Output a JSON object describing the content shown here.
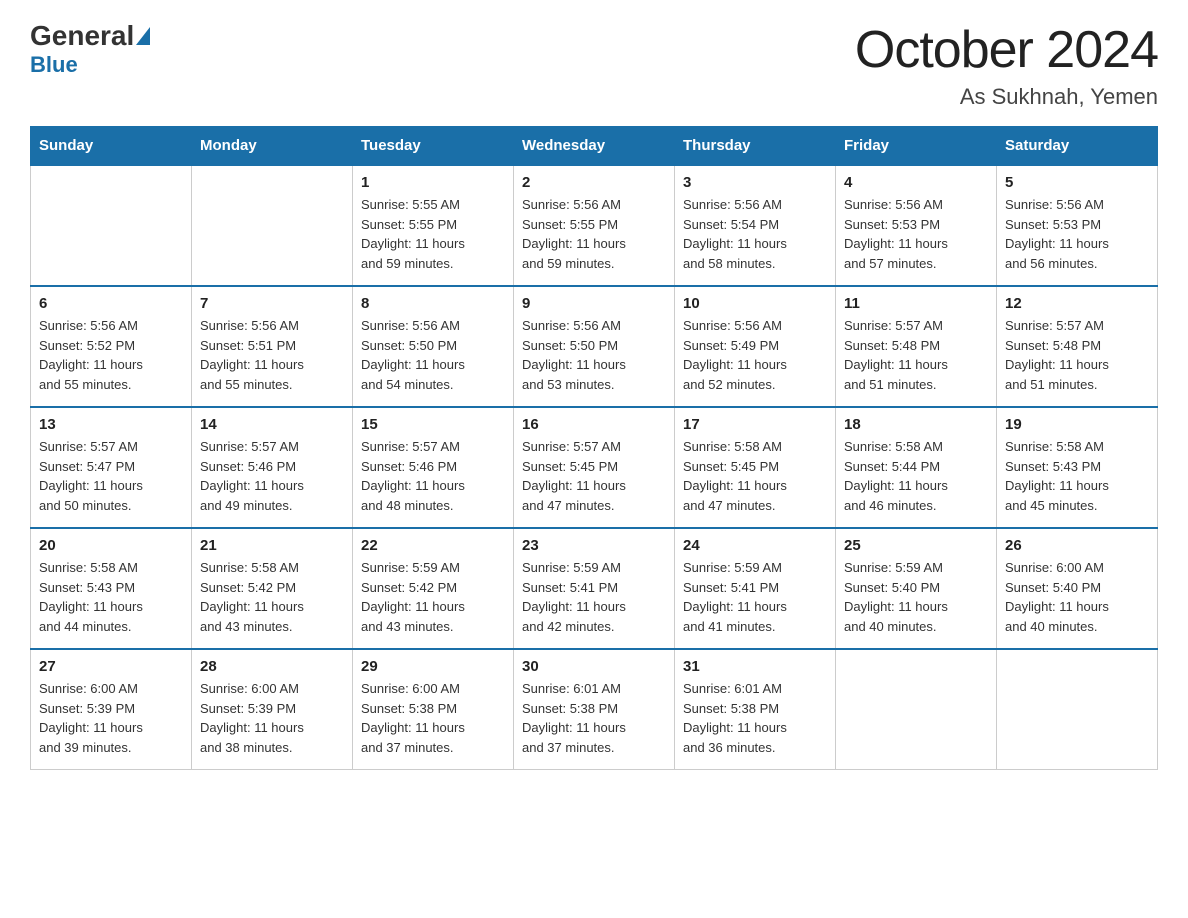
{
  "header": {
    "logo_general": "General",
    "logo_blue": "Blue",
    "title": "October 2024",
    "subtitle": "As Sukhnah, Yemen"
  },
  "weekdays": [
    "Sunday",
    "Monday",
    "Tuesday",
    "Wednesday",
    "Thursday",
    "Friday",
    "Saturday"
  ],
  "weeks": [
    [
      {
        "day": "",
        "info": ""
      },
      {
        "day": "",
        "info": ""
      },
      {
        "day": "1",
        "info": "Sunrise: 5:55 AM\nSunset: 5:55 PM\nDaylight: 11 hours\nand 59 minutes."
      },
      {
        "day": "2",
        "info": "Sunrise: 5:56 AM\nSunset: 5:55 PM\nDaylight: 11 hours\nand 59 minutes."
      },
      {
        "day": "3",
        "info": "Sunrise: 5:56 AM\nSunset: 5:54 PM\nDaylight: 11 hours\nand 58 minutes."
      },
      {
        "day": "4",
        "info": "Sunrise: 5:56 AM\nSunset: 5:53 PM\nDaylight: 11 hours\nand 57 minutes."
      },
      {
        "day": "5",
        "info": "Sunrise: 5:56 AM\nSunset: 5:53 PM\nDaylight: 11 hours\nand 56 minutes."
      }
    ],
    [
      {
        "day": "6",
        "info": "Sunrise: 5:56 AM\nSunset: 5:52 PM\nDaylight: 11 hours\nand 55 minutes."
      },
      {
        "day": "7",
        "info": "Sunrise: 5:56 AM\nSunset: 5:51 PM\nDaylight: 11 hours\nand 55 minutes."
      },
      {
        "day": "8",
        "info": "Sunrise: 5:56 AM\nSunset: 5:50 PM\nDaylight: 11 hours\nand 54 minutes."
      },
      {
        "day": "9",
        "info": "Sunrise: 5:56 AM\nSunset: 5:50 PM\nDaylight: 11 hours\nand 53 minutes."
      },
      {
        "day": "10",
        "info": "Sunrise: 5:56 AM\nSunset: 5:49 PM\nDaylight: 11 hours\nand 52 minutes."
      },
      {
        "day": "11",
        "info": "Sunrise: 5:57 AM\nSunset: 5:48 PM\nDaylight: 11 hours\nand 51 minutes."
      },
      {
        "day": "12",
        "info": "Sunrise: 5:57 AM\nSunset: 5:48 PM\nDaylight: 11 hours\nand 51 minutes."
      }
    ],
    [
      {
        "day": "13",
        "info": "Sunrise: 5:57 AM\nSunset: 5:47 PM\nDaylight: 11 hours\nand 50 minutes."
      },
      {
        "day": "14",
        "info": "Sunrise: 5:57 AM\nSunset: 5:46 PM\nDaylight: 11 hours\nand 49 minutes."
      },
      {
        "day": "15",
        "info": "Sunrise: 5:57 AM\nSunset: 5:46 PM\nDaylight: 11 hours\nand 48 minutes."
      },
      {
        "day": "16",
        "info": "Sunrise: 5:57 AM\nSunset: 5:45 PM\nDaylight: 11 hours\nand 47 minutes."
      },
      {
        "day": "17",
        "info": "Sunrise: 5:58 AM\nSunset: 5:45 PM\nDaylight: 11 hours\nand 47 minutes."
      },
      {
        "day": "18",
        "info": "Sunrise: 5:58 AM\nSunset: 5:44 PM\nDaylight: 11 hours\nand 46 minutes."
      },
      {
        "day": "19",
        "info": "Sunrise: 5:58 AM\nSunset: 5:43 PM\nDaylight: 11 hours\nand 45 minutes."
      }
    ],
    [
      {
        "day": "20",
        "info": "Sunrise: 5:58 AM\nSunset: 5:43 PM\nDaylight: 11 hours\nand 44 minutes."
      },
      {
        "day": "21",
        "info": "Sunrise: 5:58 AM\nSunset: 5:42 PM\nDaylight: 11 hours\nand 43 minutes."
      },
      {
        "day": "22",
        "info": "Sunrise: 5:59 AM\nSunset: 5:42 PM\nDaylight: 11 hours\nand 43 minutes."
      },
      {
        "day": "23",
        "info": "Sunrise: 5:59 AM\nSunset: 5:41 PM\nDaylight: 11 hours\nand 42 minutes."
      },
      {
        "day": "24",
        "info": "Sunrise: 5:59 AM\nSunset: 5:41 PM\nDaylight: 11 hours\nand 41 minutes."
      },
      {
        "day": "25",
        "info": "Sunrise: 5:59 AM\nSunset: 5:40 PM\nDaylight: 11 hours\nand 40 minutes."
      },
      {
        "day": "26",
        "info": "Sunrise: 6:00 AM\nSunset: 5:40 PM\nDaylight: 11 hours\nand 40 minutes."
      }
    ],
    [
      {
        "day": "27",
        "info": "Sunrise: 6:00 AM\nSunset: 5:39 PM\nDaylight: 11 hours\nand 39 minutes."
      },
      {
        "day": "28",
        "info": "Sunrise: 6:00 AM\nSunset: 5:39 PM\nDaylight: 11 hours\nand 38 minutes."
      },
      {
        "day": "29",
        "info": "Sunrise: 6:00 AM\nSunset: 5:38 PM\nDaylight: 11 hours\nand 37 minutes."
      },
      {
        "day": "30",
        "info": "Sunrise: 6:01 AM\nSunset: 5:38 PM\nDaylight: 11 hours\nand 37 minutes."
      },
      {
        "day": "31",
        "info": "Sunrise: 6:01 AM\nSunset: 5:38 PM\nDaylight: 11 hours\nand 36 minutes."
      },
      {
        "day": "",
        "info": ""
      },
      {
        "day": "",
        "info": ""
      }
    ]
  ]
}
